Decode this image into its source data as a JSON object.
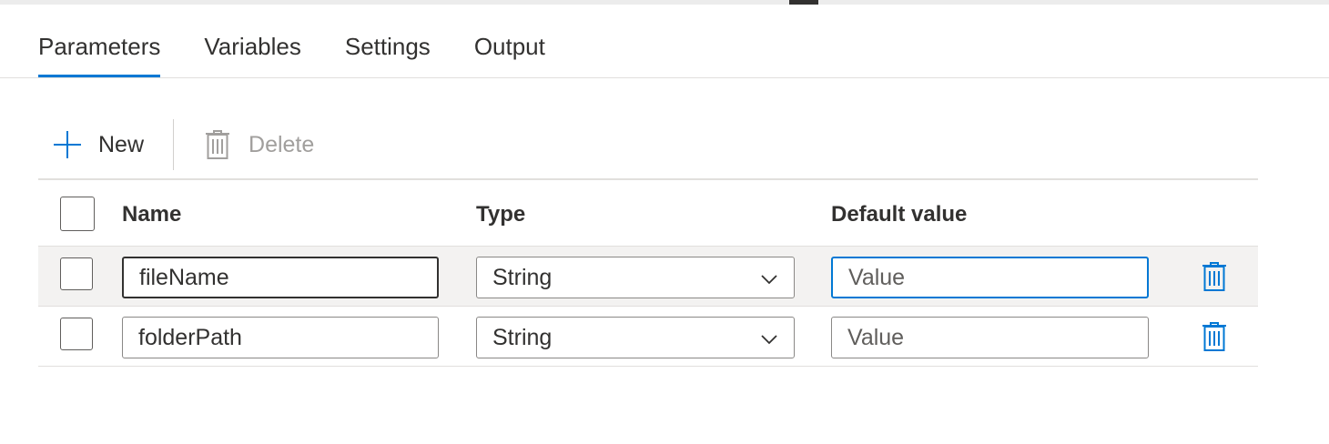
{
  "tabs": [
    {
      "label": "Parameters",
      "active": true
    },
    {
      "label": "Variables",
      "active": false
    },
    {
      "label": "Settings",
      "active": false
    },
    {
      "label": "Output",
      "active": false
    }
  ],
  "toolbar": {
    "new_label": "New",
    "new_icon": "plus-icon",
    "delete_label": "Delete",
    "delete_icon": "trash-icon",
    "delete_disabled": true
  },
  "grid": {
    "headers": {
      "name": "Name",
      "type": "Type",
      "default_value": "Default value"
    },
    "rows": [
      {
        "name": "fileName",
        "type": "String",
        "default_value": "",
        "default_placeholder": "Value"
      },
      {
        "name": "folderPath",
        "type": "String",
        "default_value": "",
        "default_placeholder": "Value"
      }
    ]
  },
  "colors": {
    "accent": "#0078d4",
    "text": "#323130",
    "disabled": "#a19f9d",
    "row_selected": "#f3f2f1"
  }
}
